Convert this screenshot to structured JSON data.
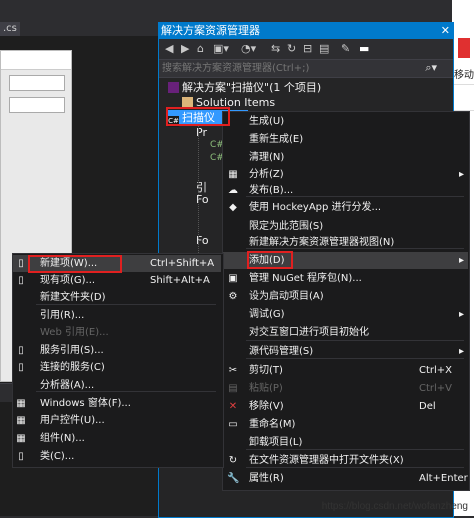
{
  "editor": {
    "tab_label": ".cs"
  },
  "solution_explorer": {
    "title": "解决方案资源管理器",
    "search_placeholder": "搜索解决方案资源管理器(Ctrl+;)",
    "solution_label": "解决方案\"扫描仪\"(1 个项目)",
    "solution_items": "Solution Items",
    "project_label": "扫描仪",
    "tree_rows": [
      "Pr",
      "C#",
      "C#",
      "引",
      "Fo",
      "Fo"
    ]
  },
  "right_panel": {
    "text": "移动"
  },
  "main_menu": [
    {
      "label": "生成(U)",
      "shortcut": ""
    },
    {
      "label": "重新生成(E)",
      "shortcut": ""
    },
    {
      "label": "清理(N)",
      "shortcut": ""
    },
    {
      "label": "分析(Z)",
      "shortcut": ""
    },
    {
      "label": "发布(B)...",
      "shortcut": ""
    },
    {
      "label": "使用 HockeyApp 进行分发...",
      "shortcut": ""
    },
    {
      "label": "限定为此范围(S)",
      "shortcut": ""
    },
    {
      "label": "新建解决方案资源管理器视图(N)",
      "shortcut": ""
    },
    {
      "label": "添加(D)",
      "shortcut": ""
    },
    {
      "label": "管理 NuGet 程序包(N)...",
      "shortcut": ""
    },
    {
      "label": "设为启动项目(A)",
      "shortcut": ""
    },
    {
      "label": "调试(G)",
      "shortcut": ""
    },
    {
      "label": "对交互窗口进行项目初始化",
      "shortcut": ""
    },
    {
      "label": "源代码管理(S)",
      "shortcut": ""
    },
    {
      "label": "剪切(T)",
      "shortcut": "Ctrl+X"
    },
    {
      "label": "粘贴(P)",
      "shortcut": "Ctrl+V"
    },
    {
      "label": "移除(V)",
      "shortcut": "Del"
    },
    {
      "label": "重命名(M)",
      "shortcut": ""
    },
    {
      "label": "卸载项目(L)",
      "shortcut": ""
    },
    {
      "label": "在文件资源管理器中打开文件夹(X)",
      "shortcut": ""
    },
    {
      "label": "属性(R)",
      "shortcut": "Alt+Enter"
    }
  ],
  "sub_menu": [
    {
      "label": "新建项(W)...",
      "shortcut": "Ctrl+Shift+A"
    },
    {
      "label": "现有项(G)...",
      "shortcut": "Shift+Alt+A"
    },
    {
      "label": "新建文件夹(D)",
      "shortcut": ""
    },
    {
      "label": "引用(R)...",
      "shortcut": ""
    },
    {
      "label": "Web 引用(E)...",
      "shortcut": ""
    },
    {
      "label": "服务引用(S)...",
      "shortcut": ""
    },
    {
      "label": "连接的服务(C)",
      "shortcut": ""
    },
    {
      "label": "分析器(A)...",
      "shortcut": ""
    },
    {
      "label": "Windows 窗体(F)...",
      "shortcut": ""
    },
    {
      "label": "用户控件(U)...",
      "shortcut": ""
    },
    {
      "label": "组件(N)...",
      "shortcut": ""
    },
    {
      "label": "类(C)...",
      "shortcut": ""
    }
  ],
  "watermark": "https://blog.csdn.net/wofanzheng",
  "colors": {
    "accent": "#007acc",
    "highlight_box": "#e02020",
    "menu_bg": "#1b1b1c",
    "selection": "#3399ff"
  }
}
